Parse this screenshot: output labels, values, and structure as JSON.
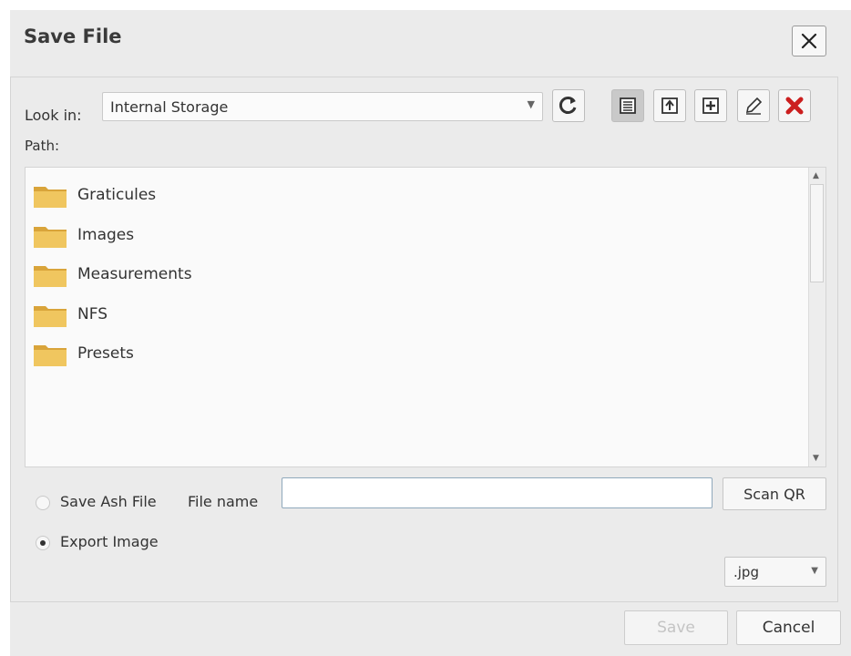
{
  "dialog": {
    "title": "Save File"
  },
  "look_in": {
    "label": "Look in:",
    "value": "Internal Storage"
  },
  "path": {
    "label": "Path:"
  },
  "toolbar": {
    "icons": [
      "refresh-icon",
      "detail-view-icon",
      "parent-folder-icon",
      "new-folder-icon",
      "rename-icon",
      "delete-icon"
    ],
    "delete_color": "#cc1f1f"
  },
  "files": [
    {
      "name": "Graticules",
      "icon": "folder-icon"
    },
    {
      "name": "Images",
      "icon": "folder-icon"
    },
    {
      "name": "Measurements",
      "icon": "folder-icon"
    },
    {
      "name": "NFS",
      "icon": "folder-icon"
    },
    {
      "name": "Presets",
      "icon": "folder-icon"
    }
  ],
  "save_mode": {
    "options": [
      {
        "label": "Save Ash File",
        "checked": false
      },
      {
        "label": "Export Image",
        "checked": true
      }
    ]
  },
  "file_name": {
    "label": "File name",
    "value": "",
    "placeholder": ""
  },
  "scan_qr": {
    "label": "Scan QR"
  },
  "extension": {
    "value": ".jpg"
  },
  "footer": {
    "save_label": "Save",
    "cancel_label": "Cancel"
  },
  "colors": {
    "dialog_bg": "#ebebeb",
    "list_bg": "#fafafa",
    "folder": "#e8b84a"
  }
}
